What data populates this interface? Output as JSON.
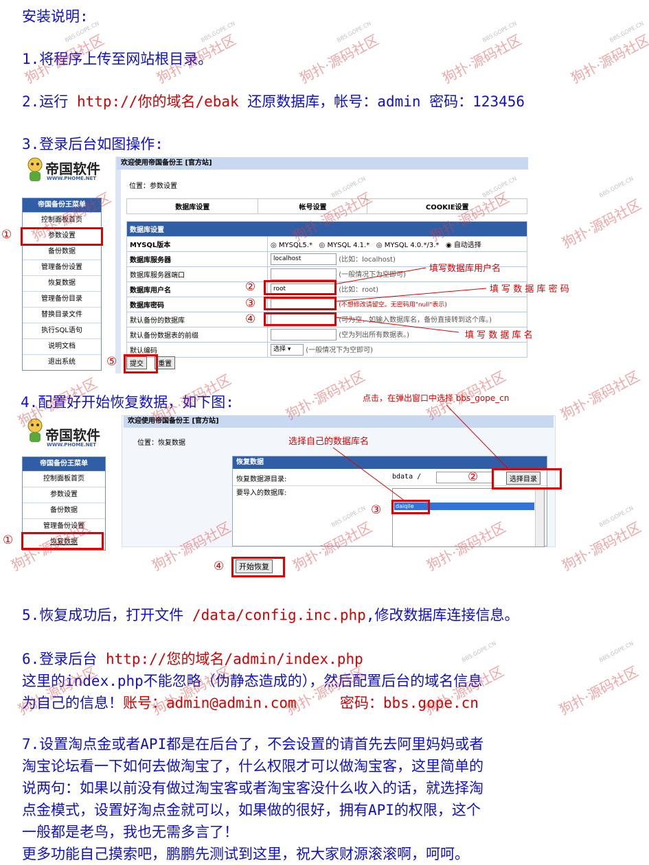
{
  "title": "安装说明:",
  "step1": "1.将程序上传至网站根目录。",
  "step2": {
    "prefix": "2.运行 ",
    "url": "http://你的域名/ebak",
    "suffix": " 还原数据库，帐号：admin 密码：123456"
  },
  "step3": "3.登录后台如图操作:",
  "step4": "4.配置好开始恢复数据，如下图:",
  "step5": {
    "prefix": "5.恢复成功后，打开文件 ",
    "path": "/data/config.inc.php",
    "suffix": ",修改数据库连接信息。"
  },
  "step6": {
    "prefix": "6.登录后台 ",
    "url": "http://您的域名/admin/index.php",
    "line2": "这里的index.php不能忽略（伪静态造成的），然后配置后台的域名信息",
    "line3_prefix": "为自己的信息！",
    "line3_account": "账号：admin@admin.com     密码：bbs.gope.cn"
  },
  "step7": [
    "7.设置淘点金或者API都是在后台了，不会设置的请首先去阿里妈妈或者",
    "淘宝论坛看一下如何去做淘宝了，什么权限才可以做淘宝客，这里简单的",
    "说两句：如果以前没有做过淘宝客或者淘宝客没什么收入的话，就选择淘",
    "点金模式，设置好淘点金就可以，如果做的很好，拥有API的权限，这个",
    "一般都是老鸟，我也无需多言了！",
    "更多功能自己摸索吧，鹏鹏先测试到这里，祝大家财源滚滚啊，呵呵。"
  ],
  "watermark": {
    "text": "狗扑·源码社区",
    "small": "BBS.GOPE.CN"
  },
  "logo": {
    "name": "帝国软件",
    "url": "WWW.PHOME.NET"
  },
  "shot1": {
    "topbar": "欢迎使用帝国备份王 [官方站]",
    "location": "位置：参数设置",
    "menu_header": "帝国备份王菜单",
    "menu": [
      "控制面板首页",
      "参数设置",
      "备份数据",
      "管理备份设置",
      "恢复数据",
      "管理备份目录",
      "替换目录文件",
      "执行SQL语句",
      "说明文档",
      "退出系统"
    ],
    "tabs": [
      "数据库设置",
      "帐号设置",
      "COOKIE设置"
    ],
    "section": "数据库设置",
    "rows": [
      {
        "label": "MYSQL版本",
        "options": [
          "MYSQL5.*",
          "MYSQL 4.1.*",
          "MYSQL 4.0.*/3.*",
          "自动选择"
        ]
      },
      {
        "label": "数据库服务器",
        "value": "localhost",
        "hint": "(比如：localhost)"
      },
      {
        "label": "数据库服务器端口",
        "value": "",
        "hint": "(一般情况下为空即可)"
      },
      {
        "label": "数据库用户名",
        "value": "root",
        "hint": "(比如：root)"
      },
      {
        "label": "数据库密码",
        "value": "",
        "hint": "(不想修改请留空。无密码用\"null\"表示)"
      },
      {
        "label": "默认备份的数据库",
        "value": "",
        "hint": "(可为空，如输入数据库名，备份直接转到这个库。)"
      },
      {
        "label": "默认备份数据表的前缀",
        "value": "",
        "hint": "(空为列出所有数据表。)"
      },
      {
        "label": "默认编码",
        "value": "选择",
        "hint": "(一般情况下为空即可)"
      }
    ],
    "submit": "提交",
    "reset": "重置",
    "notes": {
      "user": "填写数据库用户名",
      "pass": "填 写 数 据 库 密 码",
      "db": "填 写 数 据 库 名"
    },
    "marks": [
      "①",
      "②",
      "③",
      "④",
      "⑤"
    ]
  },
  "shot2": {
    "topbar": "欢迎使用帝国备份王 [官方站]",
    "location": "位置：恢复数据",
    "menu_header": "帝国备份王菜单",
    "menu": [
      "控制面板首页",
      "参数设置",
      "备份数据",
      "管理备份设置",
      "恢复数据"
    ],
    "section": "恢复数据",
    "row1_label": "恢复数据源目录:",
    "row1_value": "bdata /",
    "select_dir": "选择目录",
    "row2_label": "要导入的数据库:",
    "db_item": "daiqile",
    "start": "开始恢复",
    "note_click": "点击，在弹出窗口中选择 bbs_gope_cn",
    "note_db": "选择自己的数据库名",
    "marks": [
      "①",
      "②",
      "③",
      "④"
    ]
  }
}
